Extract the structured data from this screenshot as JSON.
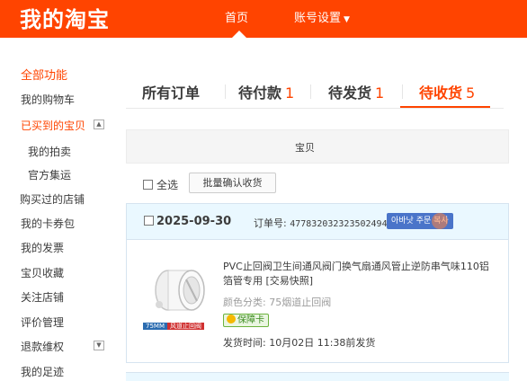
{
  "header": {
    "logo": "我的淘宝",
    "nav": {
      "home": "首页",
      "account": "账号设置"
    },
    "accent_color": "#ff4400"
  },
  "sidebar": {
    "title": "全部功能",
    "items": [
      {
        "label": "我的购物车"
      },
      {
        "label": "已买到的宝贝",
        "toggle": "▲"
      },
      {
        "label": "我的拍卖"
      },
      {
        "label": "官方集运"
      },
      {
        "label": "购买过的店铺"
      },
      {
        "label": "我的卡券包"
      },
      {
        "label": "我的发票"
      },
      {
        "label": "宝贝收藏"
      },
      {
        "label": "关注店铺"
      },
      {
        "label": "评价管理"
      },
      {
        "label": "退款维权",
        "toggle": "▼"
      },
      {
        "label": "我的足迹"
      }
    ]
  },
  "tabs": [
    {
      "label": "所有订单",
      "count": ""
    },
    {
      "label": "待付款",
      "count": "1"
    },
    {
      "label": "待发货",
      "count": "1"
    },
    {
      "label": "待收货",
      "count": "5"
    }
  ],
  "table": {
    "column_header": "宝贝"
  },
  "toolbar": {
    "select_all": "全选",
    "batch_confirm": "批量确认收货"
  },
  "order": {
    "date": "2025-09-30",
    "number_label": "订单号:",
    "number": "4778320323235024947",
    "tag": "아바낫 주문 복사",
    "product": {
      "title": "PVC止回阀卫生间通风阀门换气扇通风管止逆防串气味110铝箔管专用 [交易快照]",
      "spec": "颜色分类: 75烟道止回阀",
      "badge": "保障卡",
      "image_label_size": "75MM",
      "image_label_text": "风道止回阀",
      "ship_time": "发货时间: 10月02日 11:38前发货"
    }
  }
}
